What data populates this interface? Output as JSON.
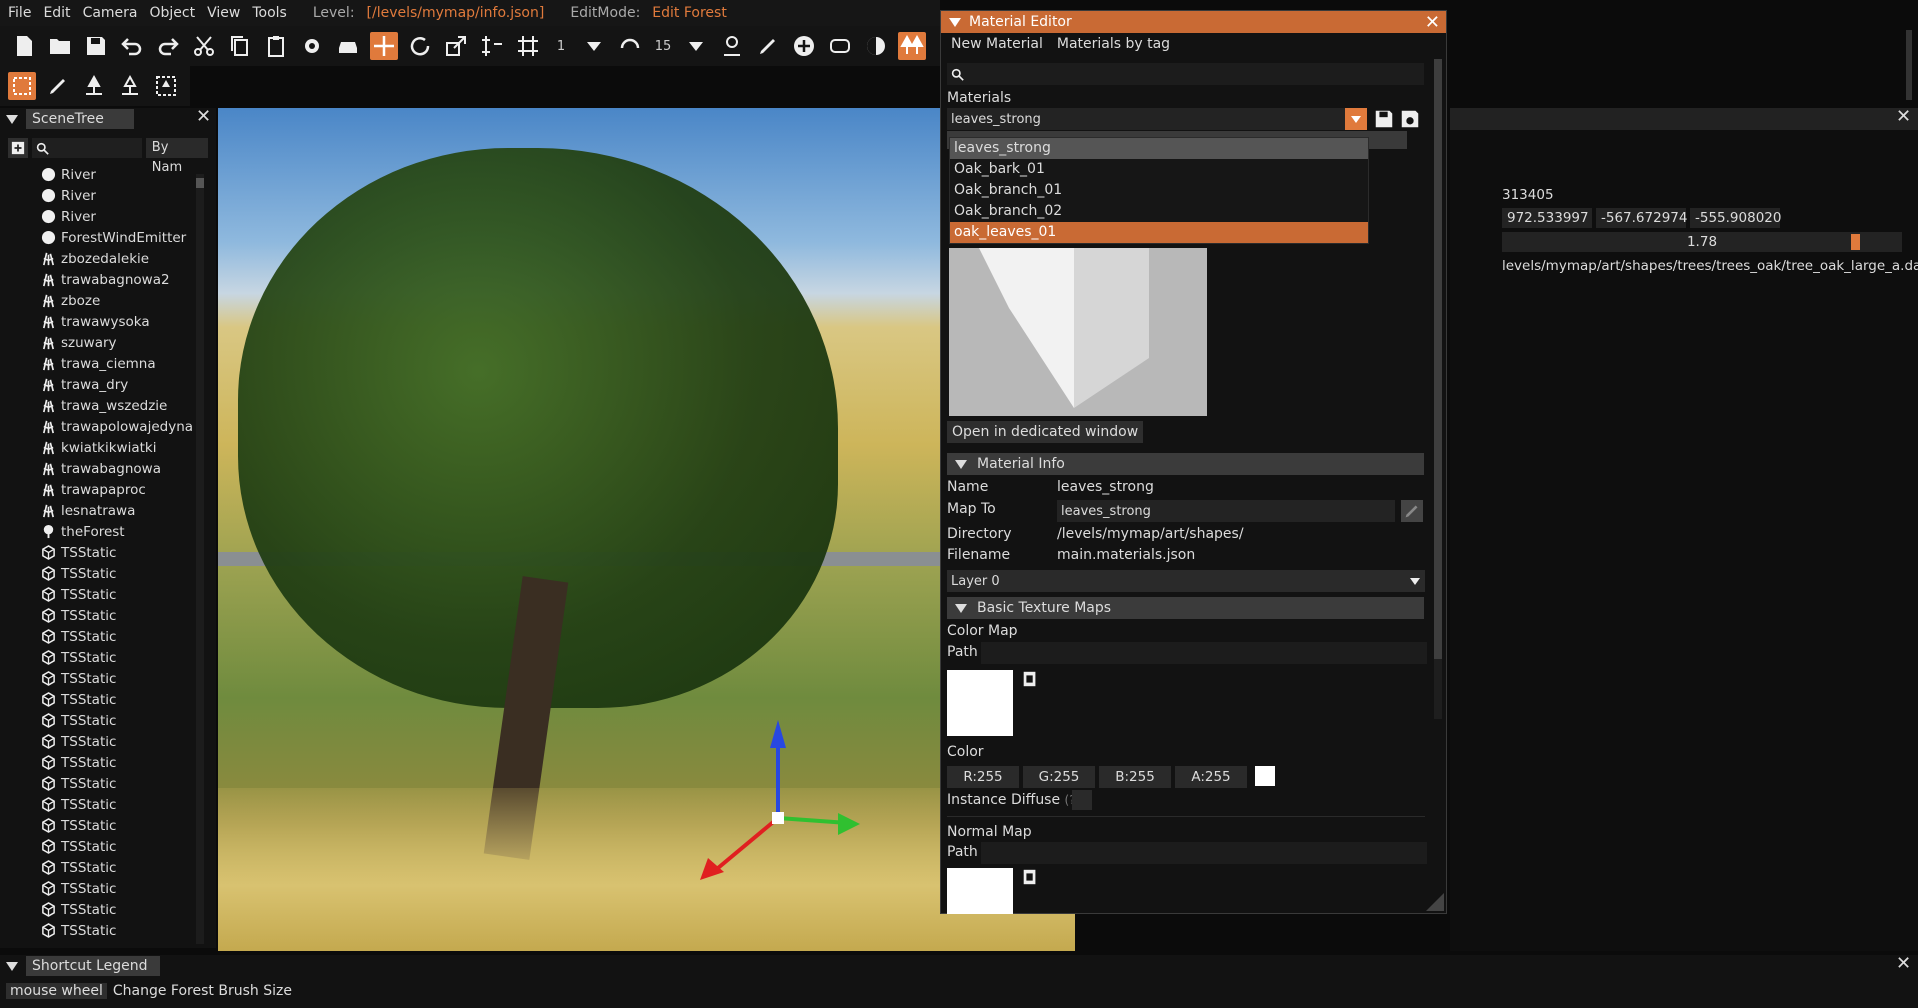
{
  "menu": {
    "items": [
      "File",
      "Edit",
      "Camera",
      "Object",
      "View",
      "Tools"
    ],
    "level_label": "Level:",
    "level_value": "[/levels/mymap/info.json]",
    "editmode_label": "EditMode:",
    "editmode_value": "Edit Forest"
  },
  "toolbar": {
    "snap_value": "1",
    "rotate_snap_value": "15"
  },
  "scene_tree": {
    "title": "SceneTree",
    "filter_label": "By Nam",
    "items": [
      {
        "label": "River",
        "icon": "river-icon"
      },
      {
        "label": "River",
        "icon": "river-icon"
      },
      {
        "label": "River",
        "icon": "river-icon"
      },
      {
        "label": "ForestWindEmitter",
        "icon": "wind-emitter-icon"
      },
      {
        "label": "zbozedalekie",
        "icon": "grass-icon"
      },
      {
        "label": "trawabagnowa2",
        "icon": "grass-icon"
      },
      {
        "label": "zboze",
        "icon": "grass-icon"
      },
      {
        "label": "trawawysoka",
        "icon": "grass-icon"
      },
      {
        "label": "szuwary",
        "icon": "grass-icon"
      },
      {
        "label": "trawa_ciemna",
        "icon": "grass-icon"
      },
      {
        "label": "trawa_dry",
        "icon": "grass-icon"
      },
      {
        "label": "trawa_wszedzie",
        "icon": "grass-icon"
      },
      {
        "label": "trawapolowajedyna",
        "icon": "grass-icon"
      },
      {
        "label": "kwiatkikwiatki",
        "icon": "grass-icon"
      },
      {
        "label": "trawabagnowa",
        "icon": "grass-icon"
      },
      {
        "label": "trawapaproc",
        "icon": "grass-icon"
      },
      {
        "label": "lesnatrawa",
        "icon": "grass-icon"
      },
      {
        "label": "theForest",
        "icon": "forest-icon"
      },
      {
        "label": "TSStatic",
        "icon": "static-mesh-icon"
      },
      {
        "label": "TSStatic",
        "icon": "static-mesh-icon"
      },
      {
        "label": "TSStatic",
        "icon": "static-mesh-icon"
      },
      {
        "label": "TSStatic",
        "icon": "static-mesh-icon"
      },
      {
        "label": "TSStatic",
        "icon": "static-mesh-icon"
      },
      {
        "label": "TSStatic",
        "icon": "static-mesh-icon"
      },
      {
        "label": "TSStatic",
        "icon": "static-mesh-icon"
      },
      {
        "label": "TSStatic",
        "icon": "static-mesh-icon"
      },
      {
        "label": "TSStatic",
        "icon": "static-mesh-icon"
      },
      {
        "label": "TSStatic",
        "icon": "static-mesh-icon"
      },
      {
        "label": "TSStatic",
        "icon": "static-mesh-icon"
      },
      {
        "label": "TSStatic",
        "icon": "static-mesh-icon"
      },
      {
        "label": "TSStatic",
        "icon": "static-mesh-icon"
      },
      {
        "label": "TSStatic",
        "icon": "static-mesh-icon"
      },
      {
        "label": "TSStatic",
        "icon": "static-mesh-icon"
      },
      {
        "label": "TSStatic",
        "icon": "static-mesh-icon"
      },
      {
        "label": "TSStatic",
        "icon": "static-mesh-icon"
      },
      {
        "label": "TSStatic",
        "icon": "static-mesh-icon"
      },
      {
        "label": "TSStatic",
        "icon": "static-mesh-icon"
      }
    ]
  },
  "material_editor": {
    "title": "Material Editor",
    "menu": [
      "New Material",
      "Materials by tag"
    ],
    "materials_label": "Materials",
    "selected_material": "leaves_strong",
    "dropdown_options": [
      "leaves_strong",
      "Oak_bark_01",
      "Oak_branch_01",
      "Oak_branch_02",
      "oak_leaves_01"
    ],
    "open_window_label": "Open in dedicated window",
    "info_section": "Material Info",
    "name_label": "Name",
    "name_value": "leaves_strong",
    "mapto_label": "Map To",
    "mapto_value": "leaves_strong",
    "directory_label": "Directory",
    "directory_value": "/levels/mymap/art/shapes/",
    "filename_label": "Filename",
    "filename_value": "main.materials.json",
    "layer_value": "Layer 0",
    "texture_section": "Basic Texture Maps",
    "color_map_label": "Color Map",
    "path_label": "Path",
    "color_label": "Color",
    "rgba": [
      "R:255",
      "G:255",
      "B:255",
      "A:255"
    ],
    "instance_diffuse_label": "Instance Diffuse",
    "instance_diffuse_hint": "(?)",
    "normal_map_label": "Normal Map",
    "path2_label": "Path"
  },
  "inspector": {
    "id_value": "313405",
    "pos_x": "972.533997",
    "pos_y": "-567.672974",
    "pos_z": "-555.908020",
    "scale_value": "1.78",
    "shape_path": "levels/mymap/art/shapes/trees/trees_oak/tree_oak_large_a.dae"
  },
  "legend": {
    "title": "Shortcut Legend",
    "key": "mouse wheel",
    "action": "Change Forest Brush Size"
  },
  "colors": {
    "accent": "#e07a3c",
    "title_bar": "#c96a34"
  }
}
